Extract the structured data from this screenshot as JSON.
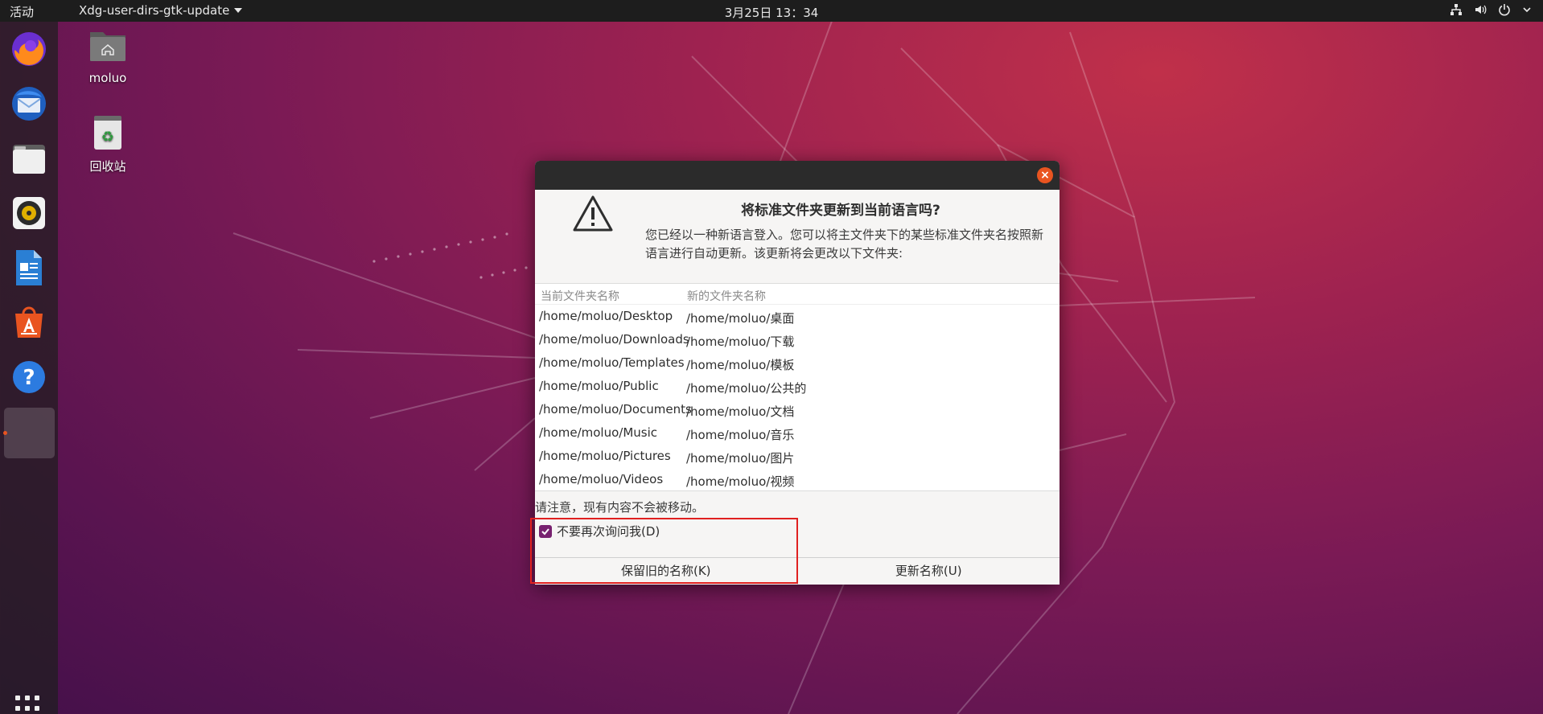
{
  "topbar": {
    "activities": "活动",
    "app_menu": "Xdg-user-dirs-gtk-update",
    "clock": "3月25日  13：34",
    "tray_icons": [
      "network-icon",
      "volume-icon",
      "power-icon",
      "chevron-down-icon"
    ]
  },
  "dock": {
    "items": [
      "firefox-icon",
      "thunderbird-icon",
      "files-icon",
      "rhythmbox-icon",
      "libreoffice-writer-icon",
      "software-center-icon",
      "help-icon",
      "running-app-icon"
    ],
    "show_apps": "show-apps-grid-icon"
  },
  "desktop": {
    "icons": [
      {
        "label": "moluo",
        "icon": "home-folder-icon"
      },
      {
        "label": "回收站",
        "icon": "trash-icon"
      }
    ]
  },
  "dialog": {
    "title": "将标准文件夹更新到当前语言吗?",
    "message": "您已经以一种新语言登入。您可以将主文件夹下的某些标准文件夹名按照新语言进行自动更新。该更新将会更改以下文件夹:",
    "columns": [
      "当前文件夹名称",
      "新的文件夹名称"
    ],
    "rows": [
      [
        "/home/moluo/Desktop",
        "/home/moluo/桌面"
      ],
      [
        "/home/moluo/Downloads",
        "/home/moluo/下载"
      ],
      [
        "/home/moluo/Templates",
        "/home/moluo/模板"
      ],
      [
        "/home/moluo/Public",
        "/home/moluo/公共的"
      ],
      [
        "/home/moluo/Documents",
        "/home/moluo/文档"
      ],
      [
        "/home/moluo/Music",
        "/home/moluo/音乐"
      ],
      [
        "/home/moluo/Pictures",
        "/home/moluo/图片"
      ],
      [
        "/home/moluo/Videos",
        "/home/moluo/视频"
      ]
    ],
    "note": "请注意，现有内容不会被移动。",
    "checkbox_label": "不要再次询问我(D)",
    "checkbox_checked": true,
    "keep_button": "保留旧的名称(K)",
    "update_button": "更新名称(U)"
  },
  "colors": {
    "accent": "#e95420",
    "checkbox": "#77216f",
    "highlight_box": "#e02020"
  }
}
